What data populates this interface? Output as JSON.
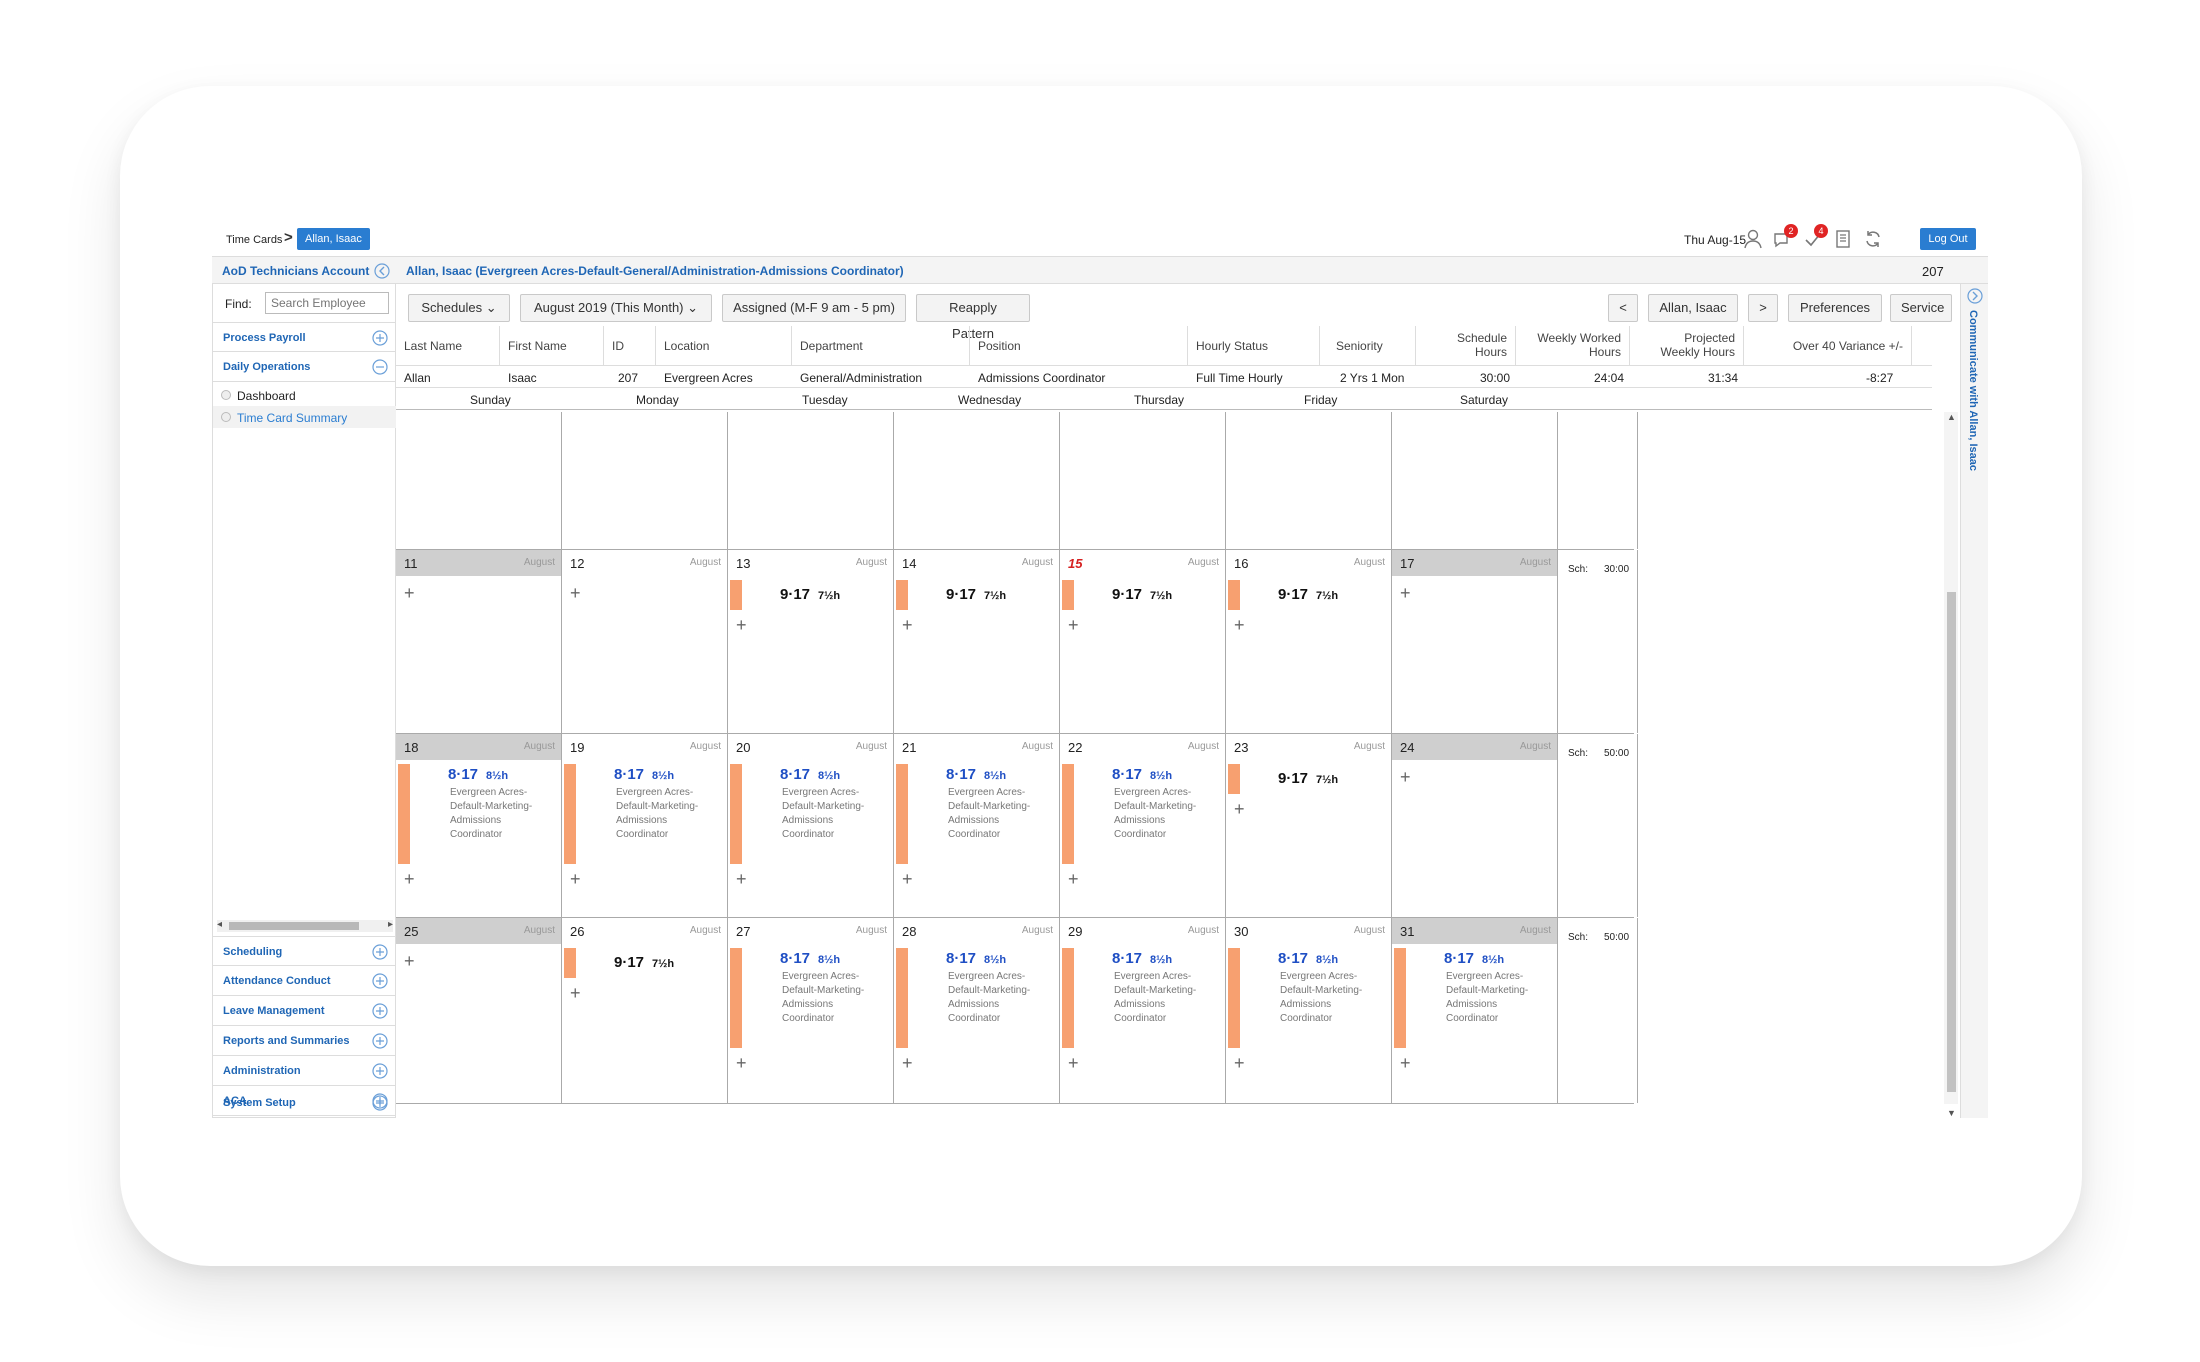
{
  "breadcrumb": {
    "root": "Time Cards",
    "separator": ">",
    "current": "Allan, Isaac"
  },
  "topbar": {
    "date": "Thu Aug-15",
    "alerts_badge": "2",
    "tasks_badge": "4",
    "logout": "Log Out"
  },
  "header": {
    "account": "AoD Technicians Account",
    "employee_title": "Allan, Isaac (Evergreen Acres-Default-General/Administration-Admissions Coordinator)",
    "employee_id": "207"
  },
  "sidebar": {
    "find_label": "Find:",
    "search_placeholder": "Search Employee",
    "top_items": [
      "Process Payroll",
      "Daily Operations"
    ],
    "sub_items": [
      "Dashboard",
      "Time Card Summary"
    ],
    "bottom_items": [
      "Scheduling",
      "Attendance Conduct",
      "Leave Management",
      "Reports and Summaries",
      "Administration",
      "ACA",
      "System Setup"
    ]
  },
  "toolbar": {
    "schedules": "Schedules",
    "period": "August 2019 (This Month)",
    "assigned": "Assigned (M-F 9 am - 5 pm)",
    "reapply": "Reapply Pattern",
    "prev": "<",
    "employee": "Allan, Isaac",
    "next": ">",
    "preferences": "Preferences",
    "service": "Service"
  },
  "info": {
    "columns": [
      "Last Name",
      "First Name",
      "ID",
      "Location",
      "Department",
      "Position",
      "Hourly Status",
      "Seniority",
      "Schedule Hours",
      "Weekly Worked Hours",
      "Projected Weekly Hours",
      "Over 40 Variance +/-"
    ],
    "row": [
      "Allan",
      "Isaac",
      "207",
      "Evergreen Acres",
      "General/Administration",
      "Admissions Coordinator",
      "Full Time Hourly",
      "2 Yrs 1 Mon",
      "30:00",
      "24:04",
      "31:34",
      "-8:27"
    ]
  },
  "days": [
    "Sunday",
    "Monday",
    "Tuesday",
    "Wednesday",
    "Thursday",
    "Friday",
    "Saturday"
  ],
  "month_label": "August",
  "sch_label": "Sch:",
  "shift_short": {
    "time": "9·17",
    "hours": "7½h"
  },
  "shift_long": {
    "time": "8·17",
    "hours": "8½h",
    "location": "Evergreen Acres-Default-Marketing-Admissions Coordinator"
  },
  "weeks": [
    {
      "days": [
        "11",
        "12",
        "13",
        "14",
        "15",
        "16",
        "17"
      ],
      "sch": "30:00"
    },
    {
      "days": [
        "18",
        "19",
        "20",
        "21",
        "22",
        "23",
        "24"
      ],
      "sch": "50:00"
    },
    {
      "days": [
        "25",
        "26",
        "27",
        "28",
        "29",
        "30",
        "31"
      ],
      "sch": "50:00"
    }
  ],
  "comm": {
    "label": "Communicate with Allan, Isaac"
  },
  "colors": {
    "accent": "#2a7dd1",
    "link": "#1f66b5",
    "shift_bar": "#f7a070",
    "today": "#d62020",
    "weekend": "#cfcfcf"
  }
}
